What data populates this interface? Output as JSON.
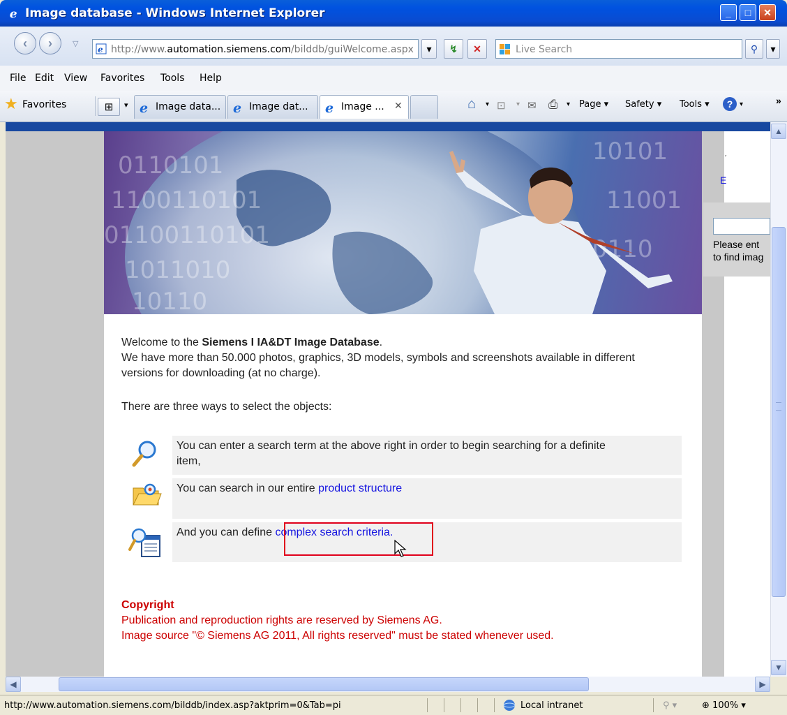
{
  "window": {
    "title": "Image database - Windows Internet Explorer",
    "minimize_icon": "minimize-icon",
    "maximize_icon": "maximize-icon",
    "close_icon": "close-icon"
  },
  "address_bar": {
    "url_prefix": "http://www.",
    "url_domain": "automation.siemens.com",
    "url_path": "/bilddb/guiWelcome.aspx"
  },
  "search": {
    "placeholder": "Live Search"
  },
  "menu": [
    "File",
    "Edit",
    "View",
    "Favorites",
    "Tools",
    "Help"
  ],
  "favorites_label": "Favorites",
  "tabs": [
    {
      "label": "Image data..."
    },
    {
      "label": "Image dat..."
    },
    {
      "label": "Image ..."
    }
  ],
  "commands": {
    "page": "Page",
    "safety": "Safety",
    "tools": "Tools"
  },
  "side_panel": {
    "line1": "Please ent",
    "line2": "to find imag",
    "link_char": "E"
  },
  "welcome": {
    "prefix": "Welcome to the ",
    "name": "Siemens I IA&DT Image Database",
    "suffix": ".",
    "line2": "We have more than 50.000 photos, graphics, 3D models, symbols and screenshots available in different",
    "line3": "versions for downloading (at no charge).",
    "intro": "There are three ways to select the objects:"
  },
  "options": [
    {
      "icon": "magnifier-icon",
      "text": "You can enter a search term at the above right in order to begin searching for a definite",
      "text2": "item,"
    },
    {
      "icon": "folder-search-icon",
      "text": "You can search in our entire ",
      "link": "product structure"
    },
    {
      "icon": "search-form-icon",
      "text": "And you can define ",
      "link": "complex search criteria",
      "suffix": "."
    }
  ],
  "copyright": {
    "title": "Copyright",
    "line1": "Publication and reproduction rights are reserved by Siemens AG.",
    "line2": "Image source \"© Siemens AG 2011, All rights reserved\" must be stated whenever used."
  },
  "status": {
    "url": "http://www.automation.siemens.com/bilddb/index.asp?aktprim=0&Tab=pi",
    "zone": "Local intranet",
    "zoom": "100%"
  },
  "colors": {
    "link": "#1414e0",
    "copyright": "#cc0000",
    "highlight_box": "#e0001b",
    "titlebar": "#0052e0"
  }
}
